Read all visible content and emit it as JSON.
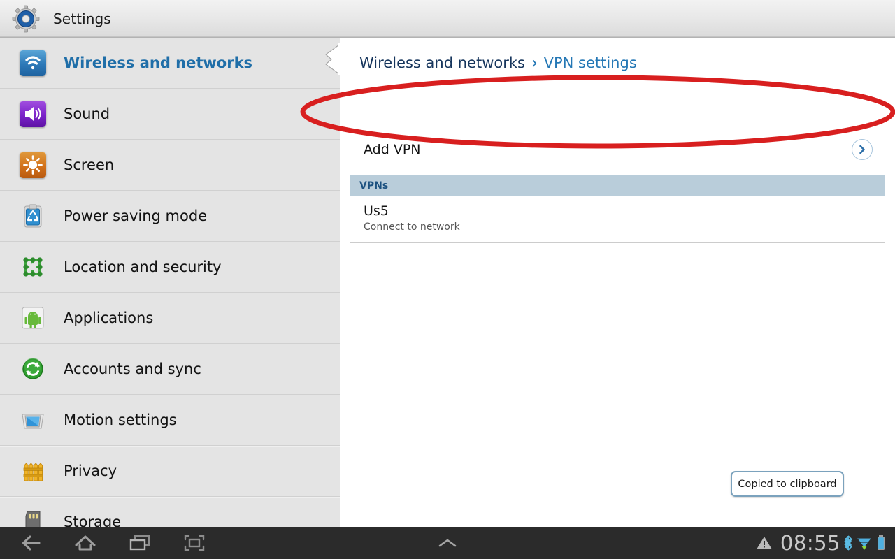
{
  "header": {
    "title": "Settings",
    "icon": "settings-gear-icon"
  },
  "sidebar": {
    "items": [
      {
        "label": "Wireless and networks",
        "icon": "wifi-icon",
        "active": true
      },
      {
        "label": "Sound",
        "icon": "speaker-icon",
        "active": false
      },
      {
        "label": "Screen",
        "icon": "brightness-icon",
        "active": false
      },
      {
        "label": "Power saving mode",
        "icon": "power-saving-icon",
        "active": false
      },
      {
        "label": "Location and security",
        "icon": "location-security-icon",
        "active": false
      },
      {
        "label": "Applications",
        "icon": "android-icon",
        "active": false
      },
      {
        "label": "Accounts and sync",
        "icon": "sync-icon",
        "active": false
      },
      {
        "label": "Motion settings",
        "icon": "motion-icon",
        "active": false
      },
      {
        "label": "Privacy",
        "icon": "fence-icon",
        "active": false
      },
      {
        "label": "Storage",
        "icon": "sdcard-icon",
        "active": false
      }
    ]
  },
  "content": {
    "breadcrumb": {
      "root": "Wireless and networks",
      "separator": "›",
      "current": "VPN settings"
    },
    "add_vpn": {
      "label": "Add VPN",
      "chevron_icon": "chevron-right-icon"
    },
    "section_header": "VPNs",
    "vpn_list": [
      {
        "name": "Us5",
        "status": "Connect to network"
      }
    ]
  },
  "toast": {
    "message": "Copied to clipboard"
  },
  "annotation": {
    "shape": "ellipse",
    "color": "#d81f1f",
    "target": "Add VPN"
  },
  "navbar": {
    "buttons": [
      {
        "name": "back-button",
        "icon": "back-arrow-icon"
      },
      {
        "name": "home-button",
        "icon": "home-icon"
      },
      {
        "name": "recents-button",
        "icon": "recent-apps-icon"
      },
      {
        "name": "capture-button",
        "icon": "screen-capture-icon"
      }
    ],
    "handle_icon": "chevron-up-icon",
    "status": {
      "warning_icon": "warning-triangle-icon",
      "clock": "08:55",
      "bluetooth_icon": "bluetooth-icon",
      "wifi_icon": "wifi-signal-icon",
      "battery_icon": "battery-icon"
    }
  },
  "colors": {
    "accent_blue": "#2477b5",
    "breadcrumb_root": "#17365d",
    "section_bg": "#b9cdda",
    "annotation_red": "#d81f1f",
    "navbar_bg": "#2b2b2b"
  }
}
